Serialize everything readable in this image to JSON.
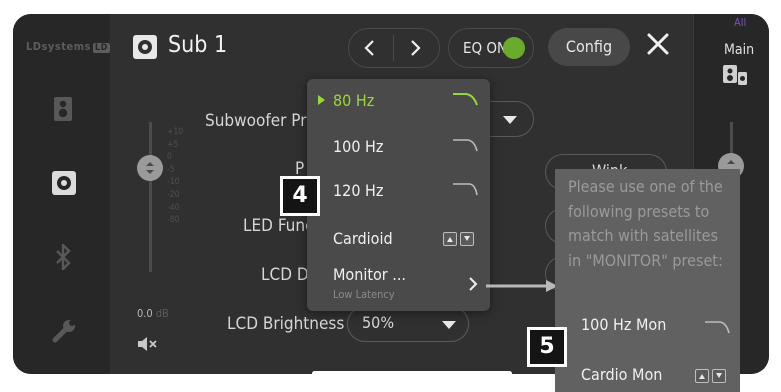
{
  "sidebar": {
    "brand": "LDsystems",
    "brand_badge": "LD",
    "icons": [
      "speaker-icon",
      "subwoofer-icon",
      "bluetooth-icon",
      "wrench-icon"
    ]
  },
  "header": {
    "title": "Sub 1",
    "eq_label": "EQ ON",
    "config_label": "Config"
  },
  "right_panel": {
    "all_label": "All",
    "main_label": "Main"
  },
  "left_fader": {
    "scale": [
      "+10",
      "+5",
      "0",
      "-5",
      "-10",
      "-20",
      "-40",
      "-80"
    ],
    "value": "0.0",
    "unit": "dB"
  },
  "settings": {
    "rows": [
      {
        "label": "Subwoofer Pre"
      },
      {
        "label": "P"
      },
      {
        "label": "LED Func"
      },
      {
        "label": "LCD Di"
      },
      {
        "label": "LCD Brightness"
      }
    ],
    "brightness_value": "50%",
    "wink_label": "Wink"
  },
  "dropdown": {
    "items": [
      {
        "label": "80 Hz",
        "selected": true
      },
      {
        "label": "100 Hz"
      },
      {
        "label": "120 Hz"
      },
      {
        "label": "Cardioid"
      },
      {
        "label": "Monitor ...",
        "sublabel": "Low Latency"
      }
    ]
  },
  "tooltip": {
    "text": "Please use one of the following presets to match with satellites in \"MONITOR\" preset:",
    "items": [
      {
        "label": "100 Hz Mon"
      },
      {
        "label": "Cardio Mon"
      }
    ]
  },
  "callouts": [
    "4",
    "5"
  ],
  "colors": {
    "accent_green": "#9ad63a",
    "eq_green": "#6aab2e",
    "all_purple": "#7a4fb5"
  }
}
